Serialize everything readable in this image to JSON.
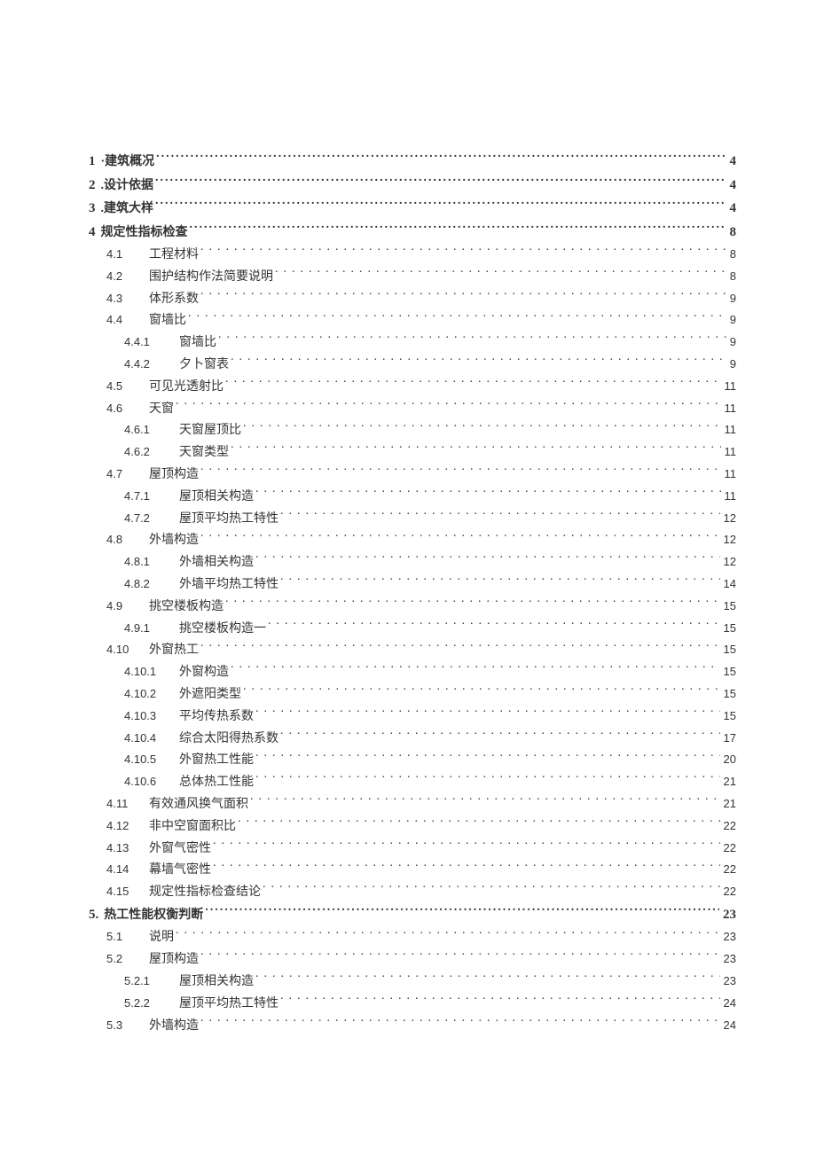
{
  "toc": [
    {
      "level": 1,
      "num": "1",
      "title": "·建筑概况",
      "page": "4"
    },
    {
      "level": 1,
      "num": "2",
      "title": ".设计依据",
      "page": "4"
    },
    {
      "level": 1,
      "num": "3",
      "title": ".建筑大样",
      "page": "4"
    },
    {
      "level": 1,
      "num": "4",
      "title": "规定性指标检查",
      "page": "8"
    },
    {
      "level": 2,
      "num": "4.1",
      "title": "工程材料",
      "page": "8"
    },
    {
      "level": 2,
      "num": "4.2",
      "title": "围护结构作法简要说明",
      "page": "8"
    },
    {
      "level": 2,
      "num": "4.3",
      "title": "体形系数",
      "page": "9"
    },
    {
      "level": 2,
      "num": "4.4",
      "title": "窗墙比",
      "page": "9"
    },
    {
      "level": 3,
      "num": "4.4.1",
      "title": "窗墙比",
      "page": "9"
    },
    {
      "level": 3,
      "num": "4.4.2",
      "title": "夕卜窗表",
      "page": "9"
    },
    {
      "level": 2,
      "num": "4.5",
      "title": "可见光透射比",
      "page": "11"
    },
    {
      "level": 2,
      "num": "4.6",
      "title": "天窗",
      "page": "11"
    },
    {
      "level": 3,
      "num": "4.6.1",
      "title": "天窗屋顶比",
      "page": "11"
    },
    {
      "level": 3,
      "num": "4.6.2",
      "title": "天窗类型",
      "page": "11"
    },
    {
      "level": 2,
      "num": "4.7",
      "title": "屋顶构造",
      "page": "11"
    },
    {
      "level": 3,
      "num": "4.7.1",
      "title": "屋顶相关构造",
      "page": "11"
    },
    {
      "level": 3,
      "num": "4.7.2",
      "title": "屋顶平均热工特性",
      "page": "12"
    },
    {
      "level": 2,
      "num": "4.8",
      "title": "外墙构造",
      "page": "12"
    },
    {
      "level": 3,
      "num": "4.8.1",
      "title": "外墙相关构造",
      "page": "12"
    },
    {
      "level": 3,
      "num": "4.8.2",
      "title": "外墙平均热工特性",
      "page": "14"
    },
    {
      "level": 2,
      "num": "4.9",
      "title": "挑空楼板构造",
      "page": "15"
    },
    {
      "level": 3,
      "num": "4.9.1",
      "title": "挑空楼板构造一",
      "page": "15"
    },
    {
      "level": 2,
      "num": "4.10",
      "title": "外窗热工",
      "page": "15"
    },
    {
      "level": 3,
      "num": "4.10.1",
      "title": "外窗构造",
      "page": "15"
    },
    {
      "level": 3,
      "num": "4.10.2",
      "title": "外遮阳类型",
      "page": "15"
    },
    {
      "level": 3,
      "num": "4.10.3",
      "title": "平均传热系数",
      "page": "15"
    },
    {
      "level": 3,
      "num": "4.10.4",
      "title": "综合太阳得热系数",
      "page": "17"
    },
    {
      "level": 3,
      "num": "4.10.5",
      "title": "外窗热工性能",
      "page": "20"
    },
    {
      "level": 3,
      "num": "4.10.6",
      "title": "总体热工性能",
      "page": "21"
    },
    {
      "level": 2,
      "num": "4.11",
      "title": "有效通风换气面积",
      "page": "21"
    },
    {
      "level": 2,
      "num": "4.12",
      "title": "非中空窗面积比",
      "page": "22"
    },
    {
      "level": 2,
      "num": "4.13",
      "title": "外窗气密性",
      "page": "22"
    },
    {
      "level": 2,
      "num": "4.14",
      "title": "幕墙气密性",
      "page": "22"
    },
    {
      "level": 2,
      "num": "4.15",
      "title": "规定性指标检查结论",
      "page": "22"
    },
    {
      "level": 1,
      "num": "5.",
      "title": "热工性能权衡判断",
      "page": "23"
    },
    {
      "level": 2,
      "num": "5.1",
      "title": "说明",
      "page": "23"
    },
    {
      "level": 2,
      "num": "5.2",
      "title": "屋顶构造",
      "page": "23"
    },
    {
      "level": 3,
      "num": "5.2.1",
      "title": "屋顶相关构造",
      "page": "23"
    },
    {
      "level": 3,
      "num": "5.2.2",
      "title": "屋顶平均热工特性",
      "page": "24"
    },
    {
      "level": 2,
      "num": "5.3",
      "title": "外墙构造",
      "page": "24"
    }
  ]
}
